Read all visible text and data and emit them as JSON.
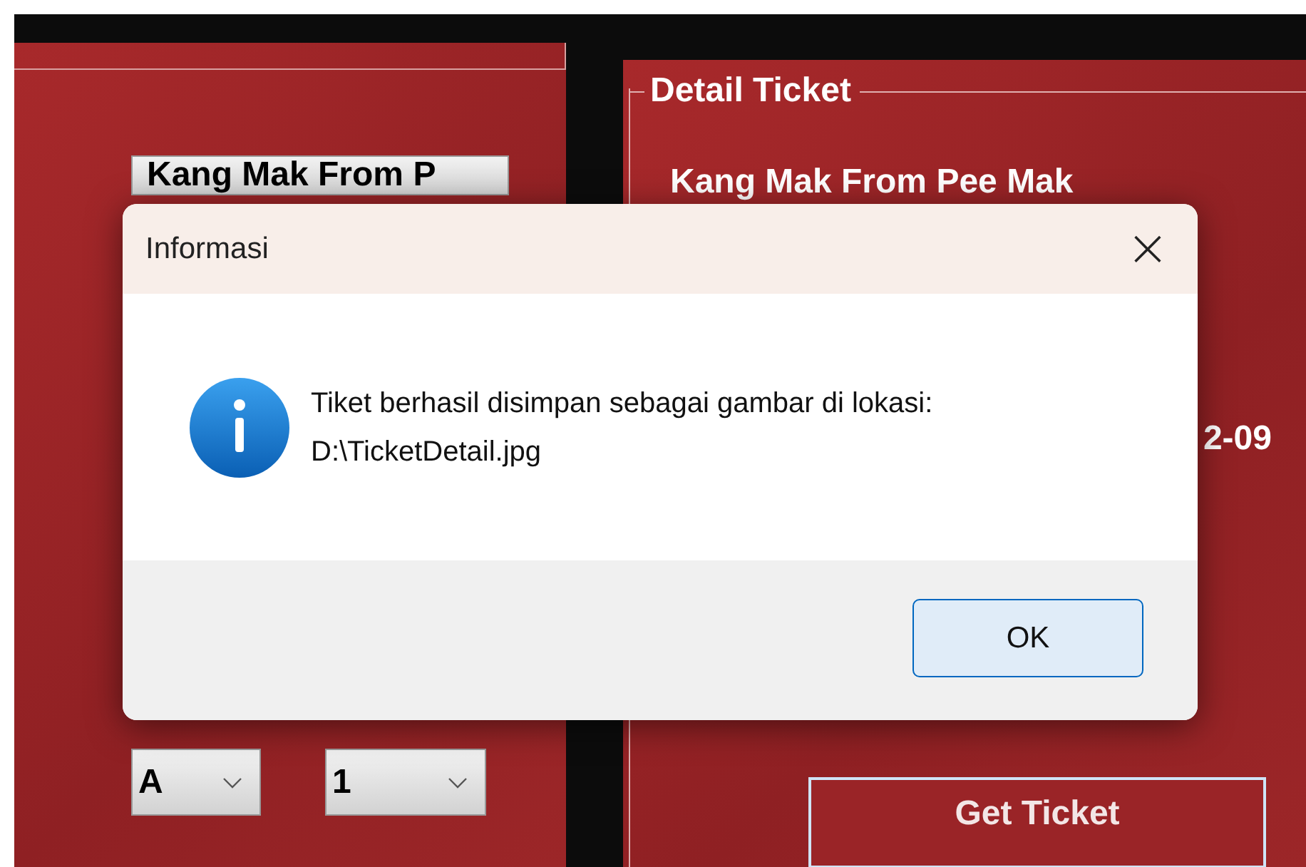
{
  "left_panel": {
    "movie_select": {
      "value": "Kang Mak From P"
    },
    "row_select": {
      "value": "A"
    },
    "seat_select": {
      "value": "1"
    }
  },
  "detail_panel": {
    "title": "Detail Ticket",
    "movie": "Kang Mak From Pee Mak",
    "date_fragment": "2-09",
    "button": "Get Ticket"
  },
  "dialog": {
    "title": "Informasi",
    "close": "×",
    "message_lines": [
      "Tiket berhasil disimpan sebagai gambar di lokasi:",
      "D:\\TicketDetail.jpg"
    ],
    "button": "OK"
  }
}
